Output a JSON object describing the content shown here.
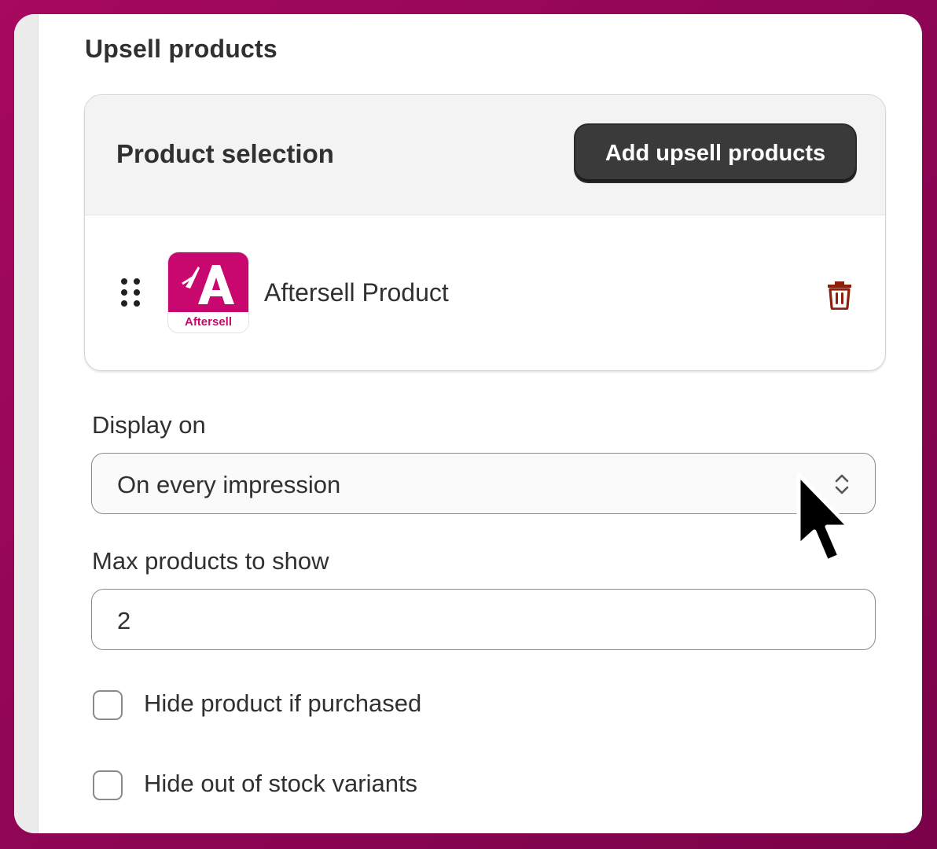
{
  "section": {
    "title": "Upsell products"
  },
  "product_selection": {
    "title": "Product selection",
    "add_button_label": "Add upsell products",
    "products": [
      {
        "name": "Aftersell Product",
        "thumbnail_text": "Aftersell",
        "thumbnail_color": "#c8076f"
      }
    ]
  },
  "display_on": {
    "label": "Display on",
    "selected": "On every impression"
  },
  "max_products": {
    "label": "Max products to show",
    "value": "2"
  },
  "options": [
    {
      "label": "Hide product if purchased",
      "checked": false
    },
    {
      "label": "Hide out of stock variants",
      "checked": false
    }
  ],
  "colors": {
    "primary_button": "#3a3a3a",
    "delete_icon": "#8e1f0b",
    "background": "#a6095f"
  }
}
